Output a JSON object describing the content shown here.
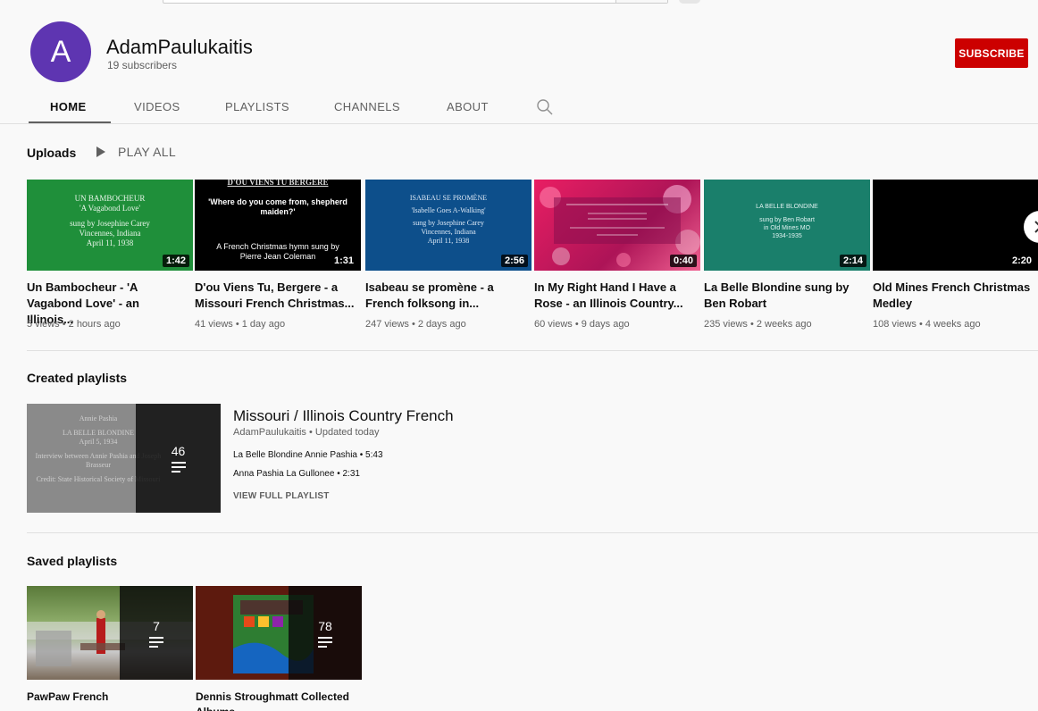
{
  "channel": {
    "avatar_letter": "A",
    "name": "AdamPaulukaitis",
    "subscribers": "19 subscribers",
    "subscribe_label": "SUBSCRIBE",
    "subscribe_color": "#cc0000",
    "avatar_color": "#5e35b1"
  },
  "tabs": [
    {
      "label": "HOME"
    },
    {
      "label": "VIDEOS"
    },
    {
      "label": "PLAYLISTS"
    },
    {
      "label": "CHANNELS"
    },
    {
      "label": "ABOUT"
    }
  ],
  "uploads": {
    "title": "Uploads",
    "play_all": "PLAY ALL",
    "videos": [
      {
        "thumb_lines": [
          "UN BAMBOCHEUR",
          "'A Vagabond Love'",
          "",
          "sung by Josephine Carey",
          "Vincennes, Indiana",
          "April 11, 1938"
        ],
        "duration": "1:42",
        "title": "Un Bambocheur - 'A Vagabond Love' - an Illinois...",
        "meta": "5 views • 2 hours ago",
        "color": "#1f8f3a"
      },
      {
        "thumb_lines": [
          "D'OU VIENS TU BERGERE",
          "'Where do you come from, shepherd maiden?'",
          "",
          "A French Christmas hymn sung by",
          "Pierre Jean Coleman"
        ],
        "duration": "1:31",
        "title": "D'ou Viens Tu, Bergere - a Missouri French Christmas...",
        "meta": "41 views • 1 day ago",
        "color": "#000000"
      },
      {
        "thumb_lines": [
          "ISABEAU SE PROMÈNE",
          "'Isabelle Goes A-Walking'",
          "",
          "sung by Josephine Carey",
          "Vincennes, Indiana",
          "April 11, 1938"
        ],
        "duration": "2:56",
        "title": "Isabeau se promène - a French folksong in...",
        "meta": "247 views • 2 days ago",
        "color": "#0d4f8b"
      },
      {
        "thumb_lines": [],
        "duration": "0:40",
        "title": "In My Right Hand I Have a Rose - an Illinois Country...",
        "meta": "60 views • 9 days ago",
        "color": "#c2185b"
      },
      {
        "thumb_lines": [
          "LA BELLE BLONDINE",
          "",
          "sung by Ben Robart",
          "in Old Mines MO",
          "1934-1935"
        ],
        "duration": "2:14",
        "title": "La Belle Blondine sung by Ben Robart",
        "meta": "235 views • 2 weeks ago",
        "color": "#1a7f6b"
      },
      {
        "thumb_lines": [],
        "duration": "2:20",
        "title": "Old Mines French Christmas Medley",
        "meta": "108 views • 4 weeks ago",
        "color": "#000000"
      }
    ]
  },
  "created_playlists": {
    "title": "Created playlists",
    "playlist": {
      "thumb_lines": [
        "Annie Pashia",
        "",
        "LA BELLE BLONDINE",
        "April 5, 1934",
        "",
        "Interview between Annie Pashia and Joseph",
        "Brasseur",
        "",
        "Credit: State Historical Society of Missouri"
      ],
      "count": "46",
      "title": "Missouri / Illinois Country French",
      "subtitle": "AdamPaulukaitis • Updated today",
      "items": [
        "La Belle Blondine Annie Pashia • 5:43",
        "Anna Pashia La Gullonee • 2:31"
      ],
      "view_full": "VIEW FULL PLAYLIST"
    }
  },
  "saved_playlists": {
    "title": "Saved playlists",
    "playlists": [
      {
        "count": "7",
        "title": "PawPaw French"
      },
      {
        "count": "78",
        "title": "Dennis Stroughmatt Collected Albums"
      }
    ]
  }
}
